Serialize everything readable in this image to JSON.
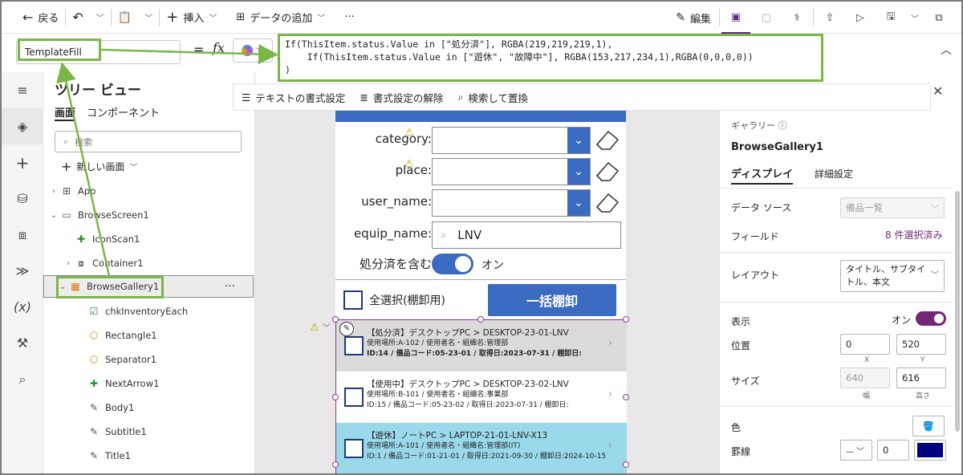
{
  "toolbar": {
    "back": "戻る",
    "insert": "挿入",
    "add_data": "データの追加",
    "more": "···",
    "edit": "編集"
  },
  "formula": {
    "property": "TemplateFill",
    "equals": "=",
    "fx": "fx",
    "line1": "If(ThisItem.status.Value in [\"処分済\"], RGBA(219,219,219,1),",
    "line2": "    If(ThisItem.status.Value in [\"遊休\", \"故障中\"], RGBA(153,217,234,1),RGBA(0,0,0,0))",
    "line3": ")"
  },
  "format_bar": {
    "format_text": "テキストの書式設定",
    "remove_format": "書式設定の解除",
    "find_replace": "検索して置換"
  },
  "tree": {
    "title": "ツリー ビュー",
    "tab_screens": "画面",
    "tab_components": "コンポーネント",
    "search_placeholder": "検索",
    "new_screen": "新しい画面",
    "items": [
      {
        "label": "App"
      },
      {
        "label": "BrowseScreen1"
      },
      {
        "label": "IconScan1"
      },
      {
        "label": "Container1"
      },
      {
        "label": "BrowseGallery1"
      },
      {
        "label": "chkInventoryEach"
      },
      {
        "label": "Rectangle1"
      },
      {
        "label": "Separator1"
      },
      {
        "label": "NextArrow1"
      },
      {
        "label": "Body1"
      },
      {
        "label": "Subtitle1"
      },
      {
        "label": "Title1"
      }
    ],
    "dots": "···"
  },
  "app": {
    "filters": [
      {
        "label": "category:"
      },
      {
        "label": "place:"
      },
      {
        "label": "user_name:"
      }
    ],
    "equip_label": "equip_name:",
    "equip_value": "LNV",
    "include_label": "処分済を含む",
    "include_value": "オン",
    "select_all": "全選択(棚卸用)",
    "bulk_button": "一括棚卸",
    "rows": [
      {
        "t1": "【処分済】デスクトップPC > DESKTOP-23-01-LNV",
        "t2": "使用場所:A-102 / 使用者名・組織名:管理部",
        "t3": "ID:14 / 備品コード:05-23-01 / 取得日:2023-07-31 / 棚卸日:",
        "bg": "#dbdbdb"
      },
      {
        "t1": "【使用中】デスクトップPC > DESKTOP-23-02-LNV",
        "t2": "使用場所:B-101 / 使用者名・組織名:事業部",
        "t3": "ID:15 / 備品コード:05-23-02 / 取得日:2023-07-31 / 棚卸日:",
        "bg": "#ffffff"
      },
      {
        "t1": "【遊休】ノートPC > LAPTOP-21-01-LNV-X13",
        "t2": "使用場所:A-101 / 使用者名・組織名:管理部(IT)",
        "t3": "ID:1 / 備品コード:01-21-01 / 取得日:2021-09-30 / 棚卸日:2024-10-15",
        "bg": "#99d9ea"
      }
    ]
  },
  "rpanel": {
    "type": "ギャラリー",
    "name": "BrowseGallery1",
    "tab_display": "ディスプレイ",
    "tab_advanced": "詳細設定",
    "data_source_label": "データ ソース",
    "data_source_value": "備品一覧",
    "fields_label": "フィールド",
    "fields_value": "8 件選択済み",
    "layout_label": "レイアウト",
    "layout_value": "タイトル、サブタイトル、本文",
    "visible_label": "表示",
    "visible_value": "オン",
    "position_label": "位置",
    "pos_x": "0",
    "pos_y": "520",
    "x_label": "X",
    "y_label": "Y",
    "size_label": "サイズ",
    "width": "640",
    "height": "616",
    "width_label": "幅",
    "height_label": "高さ",
    "color_label": "色",
    "border_label": "罫線",
    "border_width": "0",
    "border_color": "#000080"
  }
}
